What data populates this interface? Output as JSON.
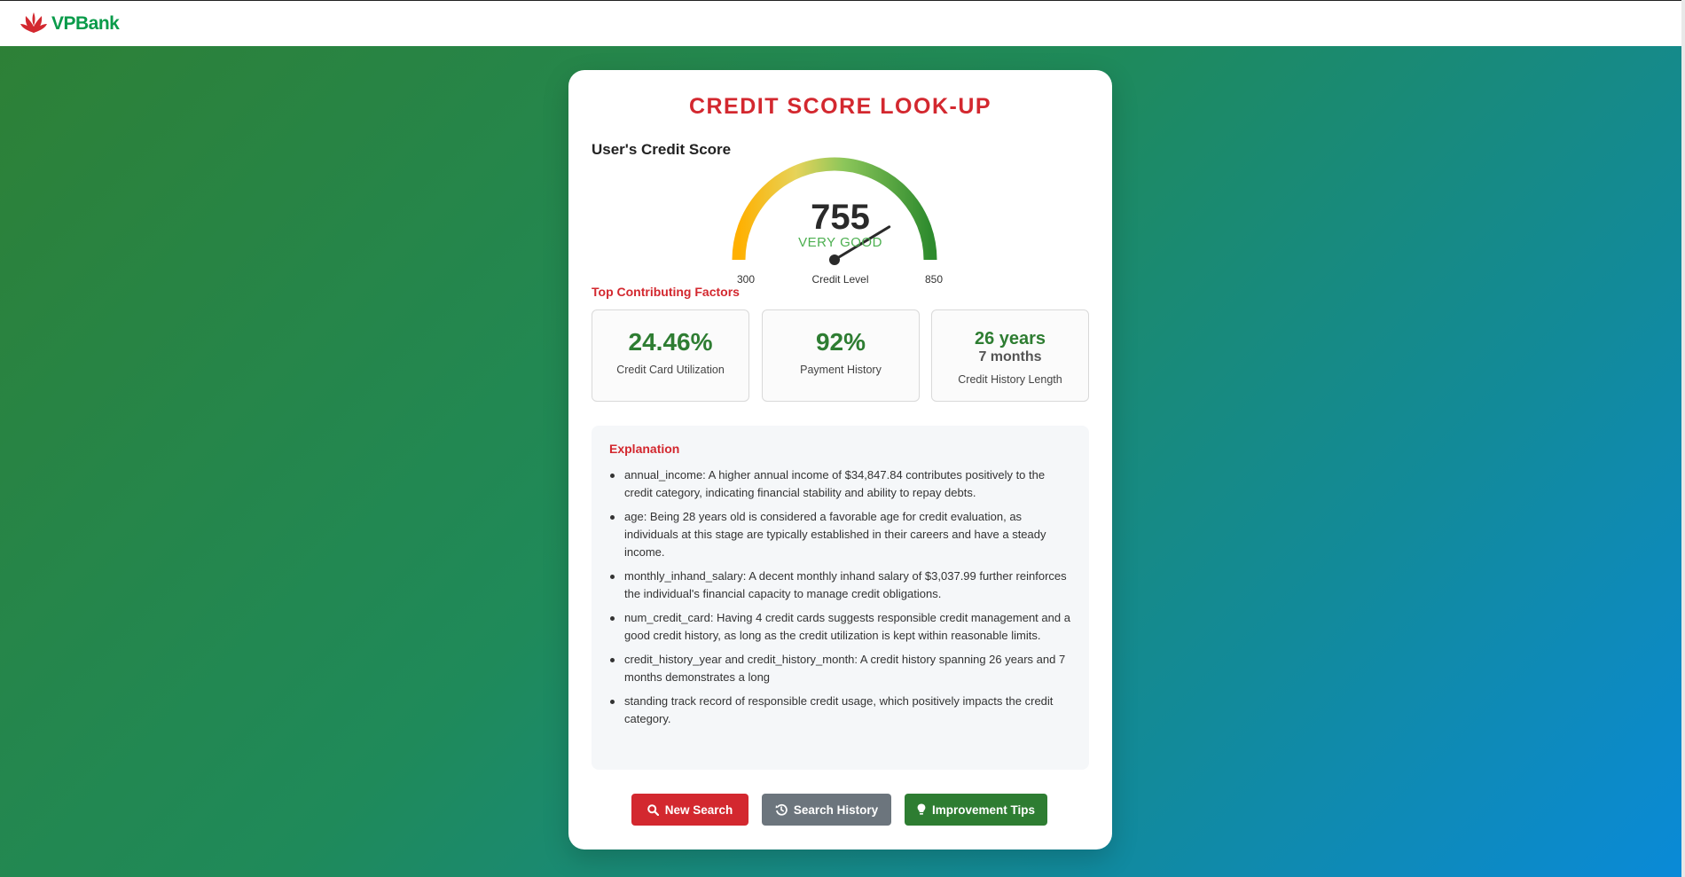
{
  "brand": {
    "name": "VPBank"
  },
  "colors": {
    "accent_red": "#d3282f",
    "accent_green": "#2e7d32",
    "button_gray": "#6c757d",
    "rating_green": "#4caf50"
  },
  "page": {
    "title": "CREDIT SCORE LOOK-UP"
  },
  "score": {
    "label": "User's Credit Score",
    "value": "755",
    "rating": "VERY GOOD",
    "gauge_min": "300",
    "gauge_max": "850",
    "gauge_caption": "Credit Level",
    "numeric_value": 755,
    "numeric_min": 300,
    "numeric_max": 850
  },
  "factors": {
    "title": "Top Contributing Factors",
    "items": [
      {
        "value": "24.46%",
        "label": "Credit Card Utilization"
      },
      {
        "value": "92%",
        "label": "Payment History"
      },
      {
        "value": "26 years",
        "value2": "7 months",
        "label": "Credit History Length"
      }
    ]
  },
  "explanation": {
    "title": "Explanation",
    "items": [
      "annual_income: A higher annual income of $34,847.84 contributes positively to the credit category, indicating financial stability and ability to repay debts.",
      "age: Being 28 years old is considered a favorable age for credit evaluation, as individuals at this stage are typically established in their careers and have a steady income.",
      "monthly_inhand_salary: A decent monthly inhand salary of $3,037.99 further reinforces the individual's financial capacity to manage credit obligations.",
      "num_credit_card: Having 4 credit cards suggests responsible credit management and a good credit history, as long as the credit utilization is kept within reasonable limits.",
      "credit_history_year and credit_history_month: A credit history spanning 26 years and 7 months demonstrates a long",
      "standing track record of responsible credit usage, which positively impacts the credit category."
    ]
  },
  "actions": {
    "new_search": "New Search",
    "search_history": "Search History",
    "improvement_tips": "Improvement Tips"
  },
  "icons": {
    "new_search": "search-icon",
    "search_history": "history-icon",
    "improvement_tips": "lightbulb-icon"
  }
}
